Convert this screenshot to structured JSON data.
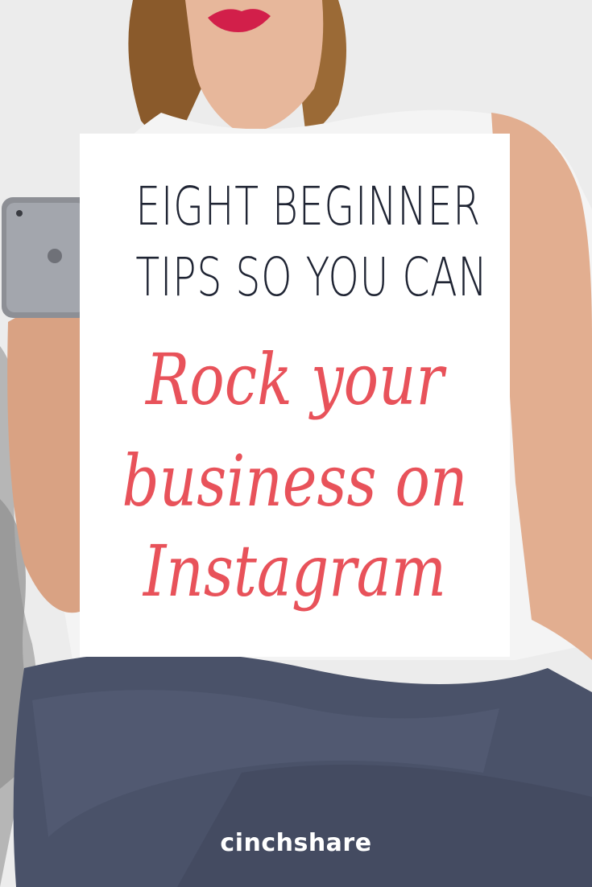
{
  "headline": {
    "line1": "EIGHT BEGINNER",
    "line2": "TIPS SO YOU CAN"
  },
  "script_title": {
    "line1": "Rock your",
    "line2": "business on",
    "line3": "Instagram"
  },
  "brand": {
    "name": "cinchshare"
  },
  "colors": {
    "headline": "#1f2433",
    "script": "#e8525a",
    "card": "#ffffff",
    "jeans": "#4a5269",
    "lips": "#d21f4a",
    "brand_text": "#ffffff"
  }
}
